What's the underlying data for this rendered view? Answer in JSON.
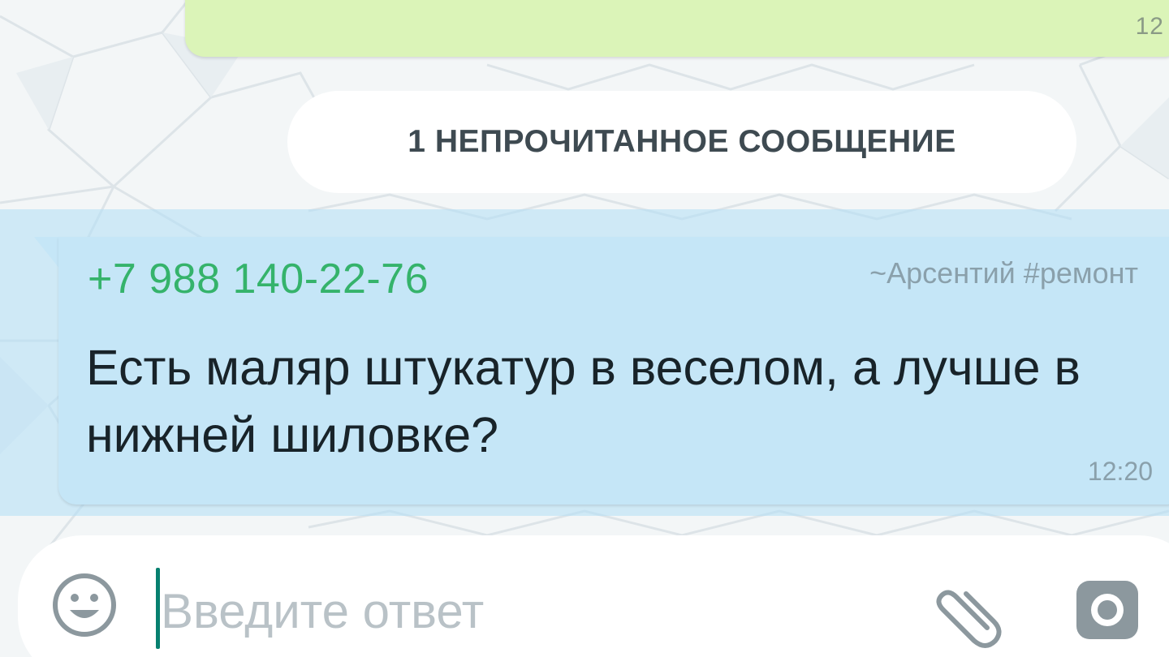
{
  "previous_message": {
    "time": "12"
  },
  "unread_divider": {
    "label": "1 НЕПРОЧИТАННОЕ СООБЩЕНИЕ"
  },
  "incoming_message": {
    "sender_phone": "+7 988 140-22-76",
    "sender_name": "~Арсентий #ремонт",
    "text": "Есть маляр штукатур в веселом, а лучше в нижней шиловке?",
    "time": "12:20"
  },
  "composer": {
    "placeholder": "Введите ответ",
    "value": "",
    "emoji_icon": "smiley-icon",
    "attach_icon": "paperclip-icon",
    "camera_icon": "camera-icon"
  },
  "colors": {
    "outgoing_bubble": "#dbf4b8",
    "incoming_bubble": "#c5e6f7",
    "sender_phone": "#35b36b",
    "accent_caret": "#07806f"
  }
}
